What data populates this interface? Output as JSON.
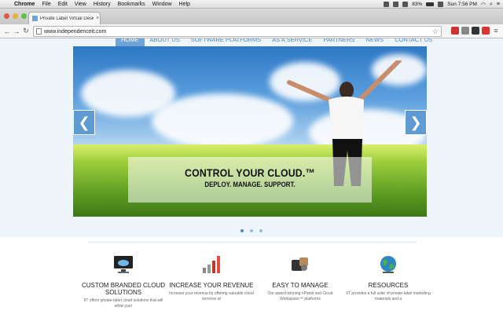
{
  "menubar": {
    "app": "Chrome",
    "items": [
      "File",
      "Edit",
      "View",
      "History",
      "Bookmarks",
      "Window",
      "Help"
    ],
    "battery": "83%",
    "clock": "Sun 7:56 PM"
  },
  "tab": {
    "title": "Private Label Virtual Deskt",
    "close": "×"
  },
  "toolbar": {
    "url": "www.independenceit.com"
  },
  "site": {
    "nav": [
      {
        "label": "HOME"
      },
      {
        "label": "ABOUT US"
      },
      {
        "label": "SOFTWARE PLATFORMS"
      },
      {
        "label": "AS A SERVICE"
      },
      {
        "label": "PARTNERS"
      },
      {
        "label": "NEWS"
      },
      {
        "label": "CONTACT US"
      }
    ],
    "slide": {
      "headline": "CONTROL YOUR CLOUD.™",
      "subline": "DEPLOY. MANAGE. SUPPORT.",
      "prev": "❮",
      "next": "❯"
    },
    "features": [
      {
        "title": "CUSTOM BRANDED CLOUD SOLUTIONS",
        "desc": "IIT offers private-label cloud solutions that will allow your"
      },
      {
        "title": "INCREASE YOUR REVENUE",
        "desc": "Increase your revenue by offering valuable cloud services at"
      },
      {
        "title": "EASY TO MANAGE",
        "desc": "Our award-winning nPanel and Cloud Workspace™ platforms"
      },
      {
        "title": "RESOURCES",
        "desc": "IIT provides a full suite of private-label marketing materials and a"
      }
    ]
  },
  "colors": {
    "accent": "#4a87c2",
    "nav_active": "#6ea4d6"
  }
}
